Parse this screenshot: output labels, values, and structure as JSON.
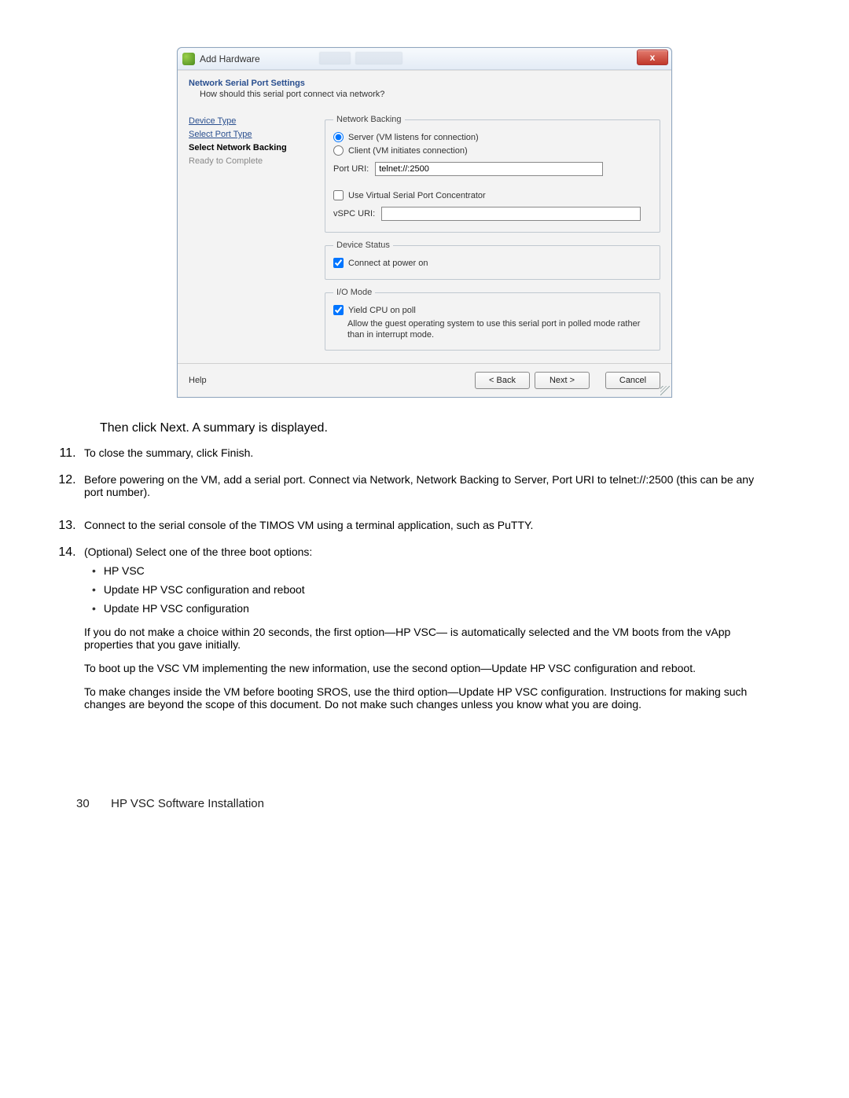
{
  "dialog": {
    "title": "Add Hardware",
    "close_label": "x",
    "section_title": "Network Serial Port Settings",
    "section_subtitle": "How should this serial port connect via network?",
    "nav": {
      "device_type": "Device Type",
      "select_port_type": "Select Port Type",
      "select_network_backing": "Select Network Backing",
      "ready_to_complete": "Ready to Complete"
    },
    "network_backing": {
      "legend": "Network Backing",
      "server_label": "Server (VM listens for connection)",
      "client_label": "Client  (VM initiates connection)",
      "port_uri_label": "Port URI:",
      "port_uri_value": "telnet://:2500",
      "use_vspc_label": "Use Virtual Serial Port Concentrator",
      "vspc_uri_label": "vSPC URI:"
    },
    "device_status": {
      "legend": "Device Status",
      "connect_label": "Connect at power on"
    },
    "io_mode": {
      "legend": "I/O Mode",
      "yield_label": "Yield CPU on poll",
      "description": "Allow the guest operating system to use this serial port in polled mode rather than in interrupt mode."
    },
    "buttons": {
      "help": "Help",
      "back": "< Back",
      "next": "Next >",
      "cancel": "Cancel"
    }
  },
  "doc": {
    "after_image": "Then click Next. A summary is displayed.",
    "step11": "To close the summary, click Finish.",
    "step12": "Before powering on the VM, add a serial port. Connect via Network, Network Backing to Server, Port URI to telnet://:2500 (this can be any port number).",
    "step13": "Connect to the serial console of the TIMOS VM using a terminal application, such as PuTTY.",
    "step14_intro": "(Optional) Select one of the three boot options:",
    "step14_bullets": {
      "b1": "HP VSC",
      "b2": "Update HP VSC configuration and reboot",
      "b3": "Update HP VSC configuration"
    },
    "step14_p1": "If you do not make a choice within 20 seconds, the first option—HP VSC— is automatically selected and the VM boots from the vApp properties that you gave initially.",
    "step14_p2": "To boot up the VSC VM implementing the new information, use the second option—Update HP VSC configuration and reboot.",
    "step14_p3": "To make changes inside the VM before booting SROS, use the third option—Update HP VSC configuration. Instructions for making such changes are beyond the scope of this document. Do not make such changes unless you know what you are doing.",
    "footer_page": "30",
    "footer_title": "HP VSC Software Installation"
  }
}
